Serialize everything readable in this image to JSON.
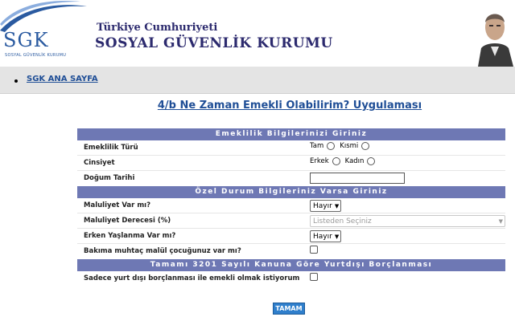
{
  "header": {
    "logo_text": "SGK",
    "logo_subtitle": "SOSYAL GÜVENLİK KURUMU",
    "org_line1": "Türkiye Cumhuriyeti",
    "org_line2": "SOSYAL GÜVENLİK KURUMU"
  },
  "nav": {
    "home_link": "SGK ANA SAYFA"
  },
  "page_title": "4/b Ne Zaman Emekli Olabilirim? Uygulaması",
  "sections": {
    "retirement": {
      "heading": "Emeklilik Bilgilerinizi Giriniz",
      "retirement_type_label": "Emeklilik Türü",
      "retirement_type_options": [
        "Tam",
        "Kısmi"
      ],
      "gender_label": "Cinsiyet",
      "gender_options": [
        "Erkek",
        "Kadın"
      ],
      "birth_date_label": "Doğum Tarihi",
      "birth_date_value": ""
    },
    "special": {
      "heading": "Özel Durum Bilgileriniz Varsa Giriniz",
      "disability_label": "Maluliyet Var mı?",
      "disability_value": "Hayır",
      "disability_degree_label": "Maluliyet Derecesi (%)",
      "disability_degree_value": "Listeden Seçiniz",
      "early_aging_label": "Erken Yaşlanma Var mı?",
      "early_aging_value": "Hayır",
      "disabled_child_label": "Bakıma muhtaç malül çocuğunuz var mı?"
    },
    "abroad": {
      "heading": "Tamamı 3201 Sayılı Kanuna Göre Yurtdışı Borçlanması",
      "abroad_only_label": "Sadece yurt dışı borçlanması ile emekli olmak istiyorum"
    }
  },
  "submit_label": "TAMAM",
  "colors": {
    "section_header_bg": "#6e78b4",
    "link_blue": "#1f4e96",
    "button_blue": "#2f7fcc",
    "nav_bg": "#e4e4e4"
  }
}
